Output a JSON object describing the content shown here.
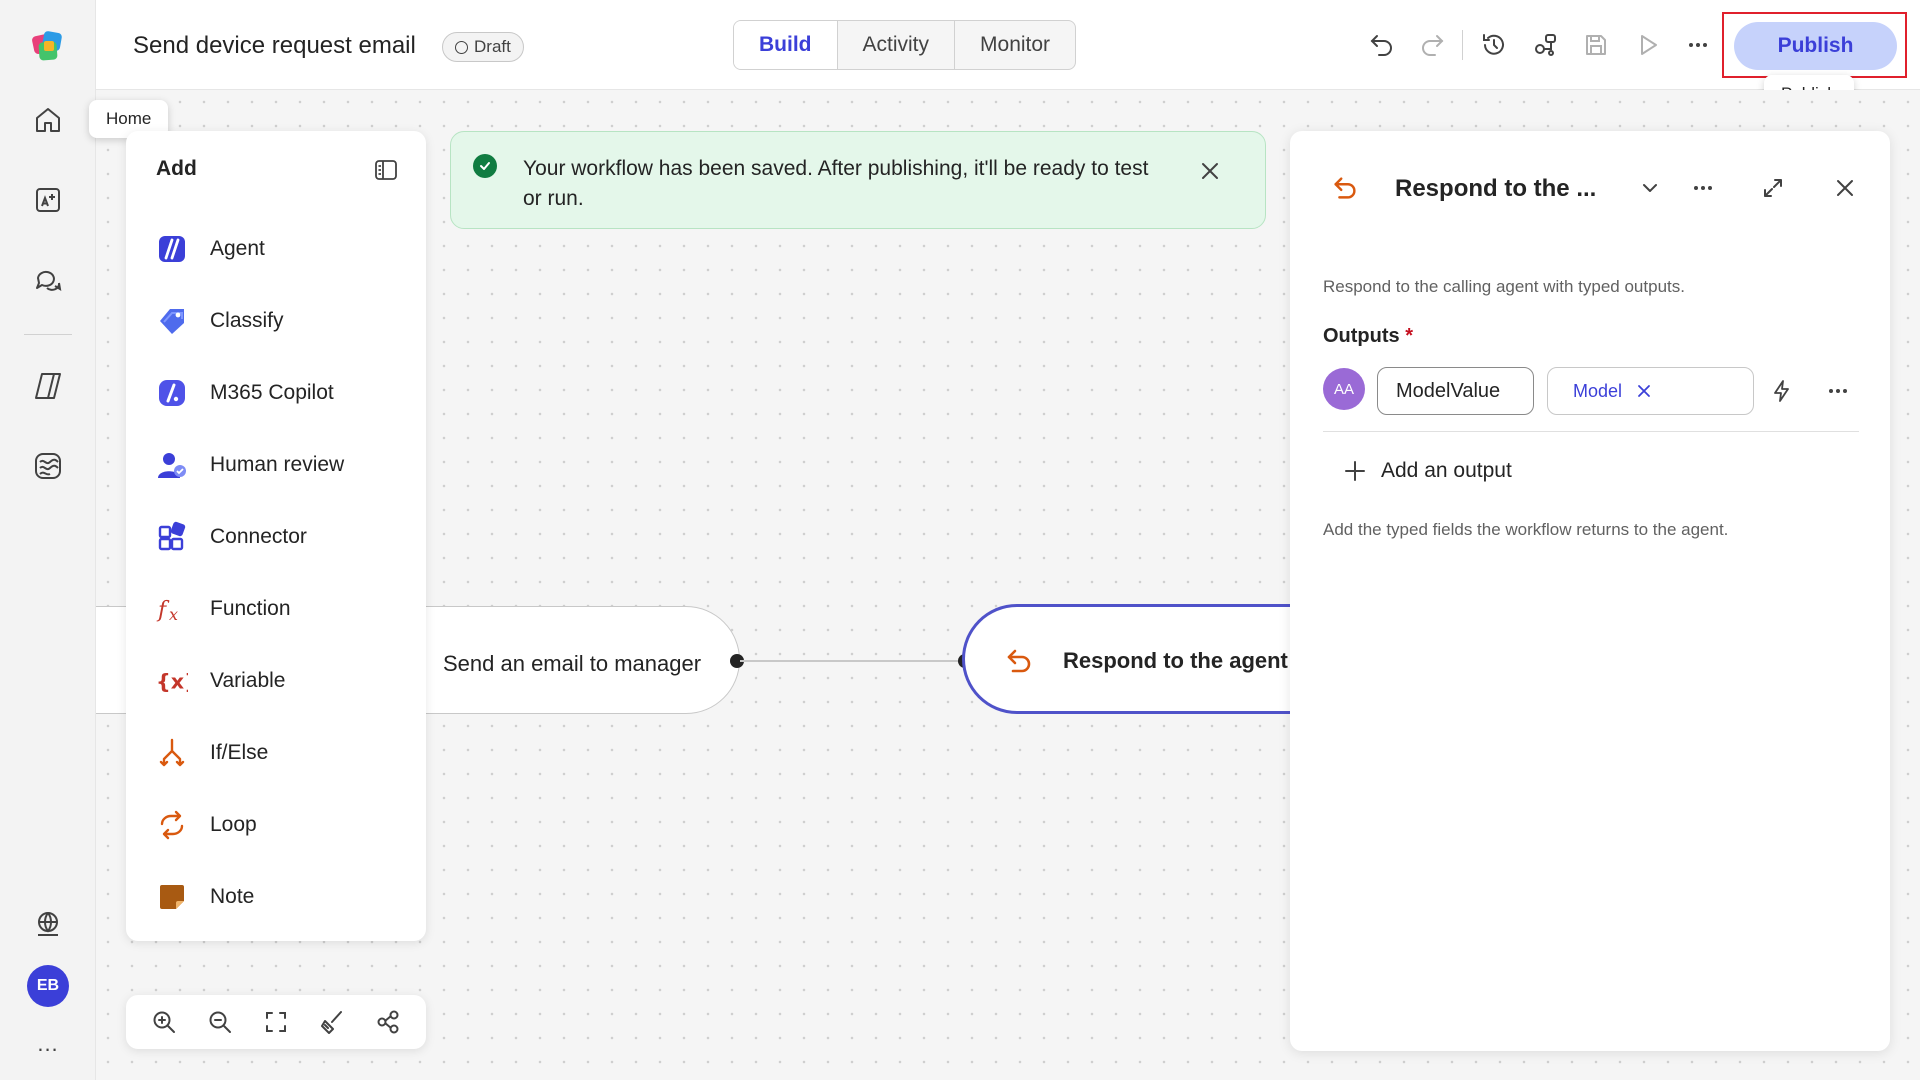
{
  "app": {
    "workflow_title": "Send device request email",
    "status_badge": "Draft"
  },
  "tabs": [
    {
      "label": "Build",
      "active": true
    },
    {
      "label": "Activity",
      "active": false
    },
    {
      "label": "Monitor",
      "active": false
    }
  ],
  "toolbar": {
    "publish_label": "Publish",
    "publish_tooltip": "Publish",
    "icons": [
      "undo-icon",
      "redo-icon",
      "history-icon",
      "connections-icon",
      "save-icon",
      "run-icon",
      "more-icon"
    ]
  },
  "rail": {
    "home_tooltip": "Home",
    "icons": [
      "app-logo",
      "home-icon",
      "create-icon",
      "chat-icon",
      "agents-icon",
      "workflows-icon",
      "environment-icon"
    ],
    "user_initials": "EB",
    "more": "..."
  },
  "add_panel": {
    "title": "Add",
    "items": [
      {
        "label": "Agent",
        "icon": "agent-icon"
      },
      {
        "label": "Classify",
        "icon": "classify-icon"
      },
      {
        "label": "M365 Copilot",
        "icon": "copilot-icon"
      },
      {
        "label": "Human review",
        "icon": "human-review-icon"
      },
      {
        "label": "Connector",
        "icon": "connector-icon"
      },
      {
        "label": "Function",
        "icon": "function-icon"
      },
      {
        "label": "Variable",
        "icon": "variable-icon"
      },
      {
        "label": "If/Else",
        "icon": "if-else-icon"
      },
      {
        "label": "Loop",
        "icon": "loop-icon"
      },
      {
        "label": "Note",
        "icon": "note-icon"
      }
    ]
  },
  "toast": {
    "message": "Your workflow has been saved. After publishing, it'll be ready to test or run."
  },
  "flow": {
    "node_email": "Send an email to manager",
    "node_respond": "Respond to the agent"
  },
  "props": {
    "title": "Respond to the ...",
    "description": "Respond to the calling agent with typed outputs.",
    "outputs_label": "Outputs",
    "required_mark": "*",
    "output": {
      "avatar_text": "AA",
      "name": "ModelValue",
      "type": "Model"
    },
    "add_output_label": "Add an output",
    "hint": "Add the typed fields the workflow returns to the agent."
  },
  "colors": {
    "accent": "#3b3fd8",
    "publish_bg": "#c6d2fb",
    "highlight_frame": "#e0202c",
    "toast_bg": "#e4f7ea",
    "success": "#107c41",
    "node_border": "#4f52c9",
    "flow_orange": "#d9590f"
  }
}
